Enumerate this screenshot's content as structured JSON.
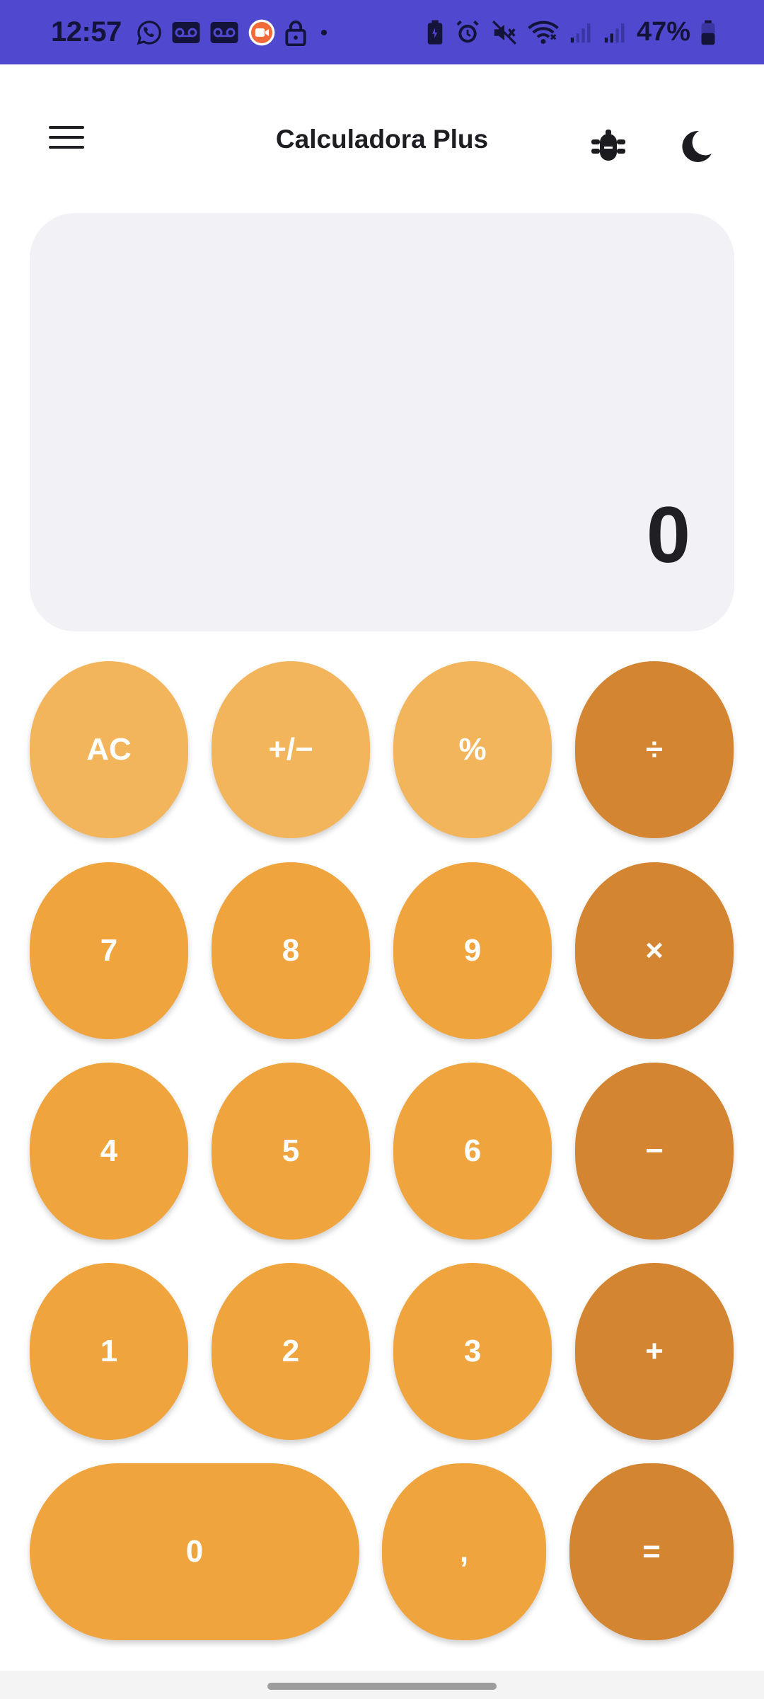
{
  "status_bar": {
    "time": "12:57",
    "battery_percent": "47%",
    "left_icons": [
      "whatsapp-icon",
      "voicemail-icon",
      "voicemail-icon",
      "screen-recorder-icon",
      "lock-icon",
      "dot-icon"
    ],
    "right_icons": [
      "battery-saver-icon",
      "alarm-icon",
      "mute-icon",
      "wifi-icon",
      "signal-icon",
      "signal-icon",
      "battery-icon"
    ],
    "background": "#5048cf"
  },
  "app_bar": {
    "title": "Calculadora Plus",
    "icons": [
      "menu-icon",
      "bug-icon",
      "moon-icon"
    ]
  },
  "display": {
    "value": "0"
  },
  "keypad": {
    "colors": {
      "function": "#f3b55b",
      "number": "#f0a43e",
      "operator": "#d48531"
    },
    "rows": [
      [
        {
          "label": "AC",
          "kind": "function"
        },
        {
          "label": "+/−",
          "kind": "function"
        },
        {
          "label": "%",
          "kind": "function"
        },
        {
          "label": "÷",
          "kind": "operator"
        }
      ],
      [
        {
          "label": "7",
          "kind": "number"
        },
        {
          "label": "8",
          "kind": "number"
        },
        {
          "label": "9",
          "kind": "number"
        },
        {
          "label": "×",
          "kind": "operator"
        }
      ],
      [
        {
          "label": "4",
          "kind": "number"
        },
        {
          "label": "5",
          "kind": "number"
        },
        {
          "label": "6",
          "kind": "number"
        },
        {
          "label": "−",
          "kind": "operator"
        }
      ],
      [
        {
          "label": "1",
          "kind": "number"
        },
        {
          "label": "2",
          "kind": "number"
        },
        {
          "label": "3",
          "kind": "number"
        },
        {
          "label": "+",
          "kind": "operator"
        }
      ],
      [
        {
          "label": "0",
          "kind": "number"
        },
        {
          "label": ",",
          "kind": "number"
        },
        {
          "label": "=",
          "kind": "operator"
        }
      ]
    ]
  }
}
